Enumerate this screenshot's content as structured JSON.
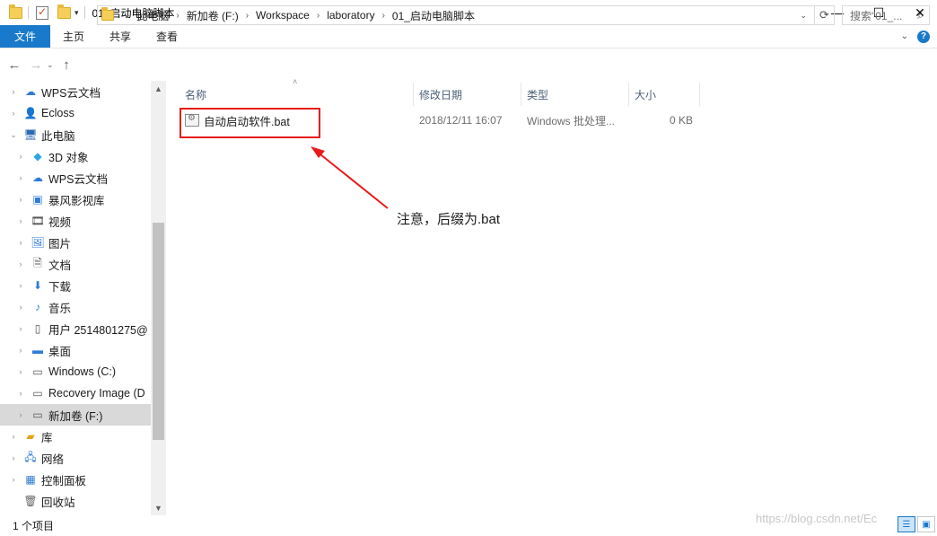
{
  "window": {
    "title": "01_启动电脑脚本",
    "min": "—",
    "max": "☐",
    "close": "✕"
  },
  "ribbon": {
    "tabs": [
      "文件",
      "主页",
      "共享",
      "查看"
    ]
  },
  "address": {
    "crumbs": [
      "此电脑",
      "新加卷 (F:)",
      "Workspace",
      "laboratory",
      "01_启动电脑脚本"
    ],
    "search_placeholder": "搜索\"01_..."
  },
  "nav": {
    "items": [
      {
        "label": "WPS云文档",
        "icon": "cloud-icon",
        "glyph": "☁",
        "color": "#2f7bd6",
        "indent": 0,
        "expander": "›"
      },
      {
        "label": "Ecloss",
        "icon": "user-icon",
        "glyph": "👤",
        "color": "#8a5a2b",
        "indent": 0,
        "expander": "›"
      },
      {
        "label": "此电脑",
        "icon": "computer-icon",
        "glyph": "🖥",
        "color": "#2d6bb5",
        "indent": 0,
        "expander": "⌄"
      },
      {
        "label": "3D 对象",
        "icon": "cube-icon",
        "glyph": "◆",
        "color": "#29a8e0",
        "indent": 1,
        "expander": "›"
      },
      {
        "label": "WPS云文档",
        "icon": "cloud-icon",
        "glyph": "☁",
        "color": "#2f7bd6",
        "indent": 1,
        "expander": "›"
      },
      {
        "label": "暴风影视库",
        "icon": "media-library-icon",
        "glyph": "▣",
        "color": "#2f7bd6",
        "indent": 1,
        "expander": "›"
      },
      {
        "label": "视频",
        "icon": "video-icon",
        "glyph": "🎞",
        "color": "#333",
        "indent": 1,
        "expander": "›"
      },
      {
        "label": "图片",
        "icon": "picture-icon",
        "glyph": "🖼",
        "color": "#2f7bd6",
        "indent": 1,
        "expander": "›"
      },
      {
        "label": "文档",
        "icon": "document-icon",
        "glyph": "🗎",
        "color": "#555",
        "indent": 1,
        "expander": "›"
      },
      {
        "label": "下载",
        "icon": "download-icon",
        "glyph": "⬇",
        "color": "#2f7bd6",
        "indent": 1,
        "expander": "›"
      },
      {
        "label": "音乐",
        "icon": "music-icon",
        "glyph": "♪",
        "color": "#2f7bd6",
        "indent": 1,
        "expander": "›"
      },
      {
        "label": "用户 2514801275@",
        "icon": "phone-icon",
        "glyph": "▯",
        "color": "#555",
        "indent": 1,
        "expander": "›"
      },
      {
        "label": "桌面",
        "icon": "desktop-icon",
        "glyph": "▬",
        "color": "#2f7bd6",
        "indent": 1,
        "expander": "›"
      },
      {
        "label": "Windows (C:)",
        "icon": "drive-c-icon",
        "glyph": "▭",
        "color": "#555",
        "indent": 1,
        "expander": "›"
      },
      {
        "label": "Recovery Image (D",
        "icon": "drive-icon",
        "glyph": "▭",
        "color": "#555",
        "indent": 1,
        "expander": "›"
      },
      {
        "label": "新加卷 (F:)",
        "icon": "drive-icon",
        "glyph": "▭",
        "color": "#555",
        "indent": 1,
        "expander": "›",
        "selected": true
      },
      {
        "label": "库",
        "icon": "library-icon",
        "glyph": "▰",
        "color": "#e3a21a",
        "indent": 0,
        "expander": "›"
      },
      {
        "label": "网络",
        "icon": "network-icon",
        "glyph": "🖧",
        "color": "#2f7bd6",
        "indent": 0,
        "expander": "›"
      },
      {
        "label": "控制面板",
        "icon": "control-panel-icon",
        "glyph": "▦",
        "color": "#2f7bd6",
        "indent": 0,
        "expander": "›"
      },
      {
        "label": "回收站",
        "icon": "recycle-bin-icon",
        "glyph": "🗑",
        "color": "#666",
        "indent": 0,
        "expander": ""
      }
    ]
  },
  "columns": {
    "name": "名称",
    "modified": "修改日期",
    "type": "类型",
    "size": "大小"
  },
  "files": [
    {
      "name": "自动启动软件.bat",
      "modified": "2018/12/11 16:07",
      "type": "Windows 批处理...",
      "size": "0 KB"
    }
  ],
  "annotation": {
    "text": "注意，后缀为.bat",
    "color": "#e81b1b"
  },
  "status": {
    "item_count": "1 个项目"
  },
  "watermark": "https://blog.csdn.net/Ec"
}
